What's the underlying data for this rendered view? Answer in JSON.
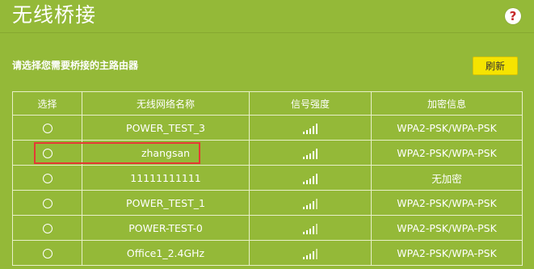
{
  "header": {
    "title": "无线桥接",
    "help_icon": "question-circle-icon"
  },
  "subtitle": "请选择您需要桥接的主路由器",
  "refresh_label": "刷新",
  "table": {
    "columns": [
      "选择",
      "无线网络名称",
      "信号强度",
      "加密信息"
    ],
    "rows": [
      {
        "ssid": "POWER_TEST_3",
        "signal_bars": 5,
        "signal_of": 5,
        "encryption": "WPA2-PSK/WPA-PSK",
        "selected": false
      },
      {
        "ssid": "zhangsan",
        "signal_bars": 5,
        "signal_of": 5,
        "encryption": "WPA2-PSK/WPA-PSK",
        "selected": false,
        "highlighted": true
      },
      {
        "ssid": "11111111111",
        "signal_bars": 5,
        "signal_of": 5,
        "encryption": "无加密",
        "selected": false
      },
      {
        "ssid": "POWER_TEST_1",
        "signal_bars": 4,
        "signal_of": 5,
        "encryption": "WPA2-PSK/WPA-PSK",
        "selected": false
      },
      {
        "ssid": "POWER-TEST-0",
        "signal_bars": 4,
        "signal_of": 5,
        "encryption": "WPA2-PSK/WPA-PSK",
        "selected": false
      },
      {
        "ssid": "Office1_2.4GHz",
        "signal_bars": 4,
        "signal_of": 5,
        "encryption": "WPA2-PSK/WPA-PSK",
        "selected": false
      }
    ]
  },
  "colors": {
    "background": "#94b938",
    "button": "#f6e400",
    "highlight": "#e53935",
    "help_icon": "#c62828"
  }
}
